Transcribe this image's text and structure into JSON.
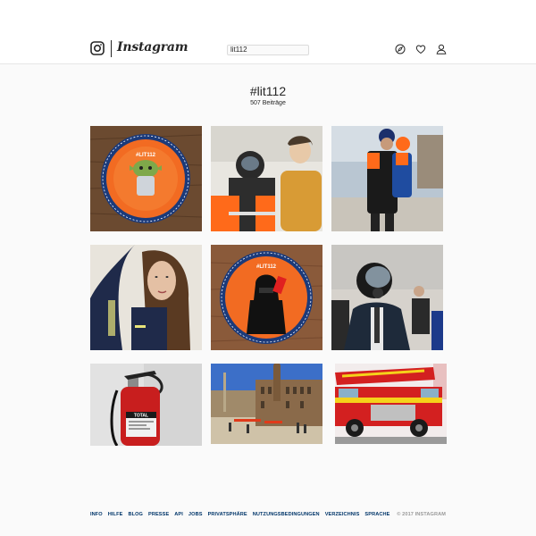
{
  "header": {
    "brand": "Instagram",
    "search_value": "lit112"
  },
  "hashtag": {
    "title": "#lit112",
    "posts_count": "507 Beiträge"
  },
  "posts": [
    {
      "badge": "#LIT112"
    },
    {},
    {},
    {},
    {
      "badge": "#LIT112"
    },
    {},
    {
      "label": "TOTAL"
    },
    {},
    {}
  ],
  "footer": {
    "links": [
      "INFO",
      "HILFE",
      "BLOG",
      "PRESSE",
      "API",
      "JOBS",
      "PRIVATSPHÄRE",
      "NUTZUNGSBEDINGUNGEN",
      "VERZEICHNIS",
      "SPRACHE"
    ],
    "copyright": "© 2017 INSTAGRAM"
  },
  "colors": {
    "accent_link": "#003569",
    "patch_orange": "#f26b22",
    "patch_blue": "#1b3a7a",
    "fire_red": "#d32020"
  },
  "icons": {
    "logo": "instagram-camera-icon",
    "explore": "compass-icon",
    "activity": "heart-icon",
    "profile": "user-icon"
  }
}
